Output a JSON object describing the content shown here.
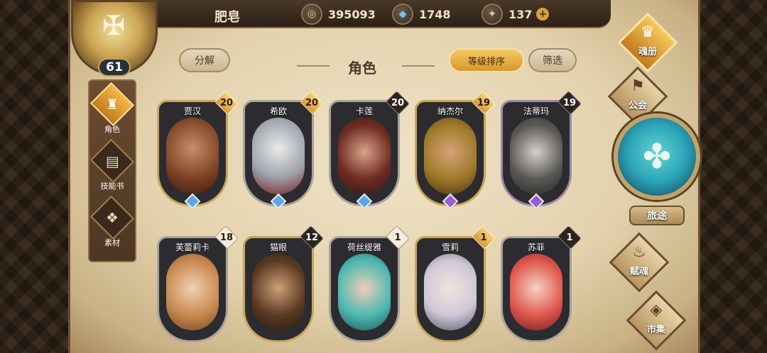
{
  "player": {
    "name": "肥皂",
    "level": "61"
  },
  "currencies": [
    {
      "icon": "coin-icon",
      "value": "395093"
    },
    {
      "icon": "crystal-icon",
      "value": "1748"
    },
    {
      "icon": "gem-icon",
      "value": "137"
    }
  ],
  "left_nav": [
    {
      "label": "角色",
      "icon": "helmet-icon",
      "active": true
    },
    {
      "label": "技能书",
      "icon": "book-icon",
      "active": false
    },
    {
      "label": "素材",
      "icon": "material-icon",
      "active": false
    }
  ],
  "header": {
    "decompose_label": "分解",
    "title": "角色",
    "sort_label": "等级排序",
    "filter_label": "筛选"
  },
  "characters": [
    {
      "name": "贾汉",
      "level": "20",
      "badge": "gold",
      "gem": "blue"
    },
    {
      "name": "希欧",
      "level": "20",
      "badge": "gold",
      "gem": "blue"
    },
    {
      "name": "卡莲",
      "level": "20",
      "badge": "dark",
      "gem": "blue"
    },
    {
      "name": "纳杰尔",
      "level": "19",
      "badge": "gold",
      "gem": "purple"
    },
    {
      "name": "法蒂玛",
      "level": "19",
      "badge": "dark",
      "gem": "purple"
    },
    {
      "name": "芙蕾莉卡",
      "level": "18",
      "badge": "light",
      "gem": "none"
    },
    {
      "name": "猫眼",
      "level": "12",
      "badge": "dark",
      "gem": "none"
    },
    {
      "name": "荷丝缇雅",
      "level": "1",
      "badge": "light",
      "gem": "none"
    },
    {
      "name": "雪莉",
      "level": "1",
      "badge": "gold",
      "gem": "none"
    },
    {
      "name": "苏菲",
      "level": "1",
      "badge": "dark",
      "gem": "none"
    }
  ],
  "right_nav": {
    "soul_book": "魂册",
    "guild": "公会",
    "journey": "旅途",
    "soul_grant": "赋魂",
    "market": "市集"
  },
  "colors": {
    "accent_gold": "#f5c964",
    "parchment": "#e3d2ad",
    "teal": "#2aa4b8"
  }
}
